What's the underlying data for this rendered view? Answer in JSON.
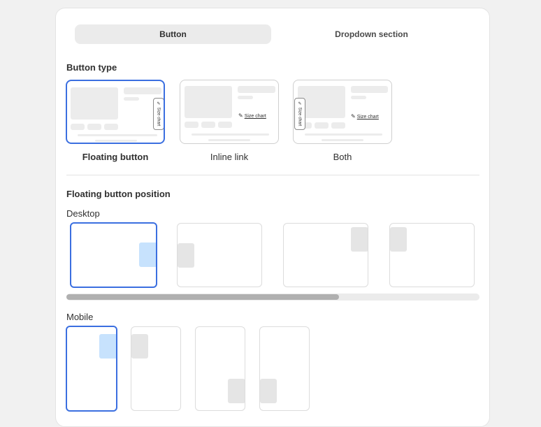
{
  "tabs": [
    {
      "label": "Button",
      "active": true
    },
    {
      "label": "Dropdown section",
      "active": false
    }
  ],
  "button_type": {
    "heading": "Button type",
    "selected": "Floating button",
    "options": [
      {
        "label": "Floating button"
      },
      {
        "label": "Inline link"
      },
      {
        "label": "Both"
      }
    ],
    "preview_text": "Size chart",
    "icon": "ruler-icon"
  },
  "floating_position": {
    "heading": "Floating button position",
    "desktop": {
      "label": "Desktop",
      "options": [
        {
          "name": "right-middle",
          "selected": true
        },
        {
          "name": "left-middle",
          "selected": false
        },
        {
          "name": "right-top",
          "selected": false
        },
        {
          "name": "left-top",
          "selected": false
        }
      ],
      "scroll_fraction_visible": 0.66
    },
    "mobile": {
      "label": "Mobile",
      "options": [
        {
          "name": "right-top",
          "selected": true
        },
        {
          "name": "left-top",
          "selected": false
        },
        {
          "name": "right-bottom",
          "selected": false
        },
        {
          "name": "left-bottom",
          "selected": false
        }
      ]
    }
  },
  "colors": {
    "accent": "#3b6fe0",
    "active_marker": "#c7e2fd",
    "inactive_marker": "#e5e5e5"
  }
}
